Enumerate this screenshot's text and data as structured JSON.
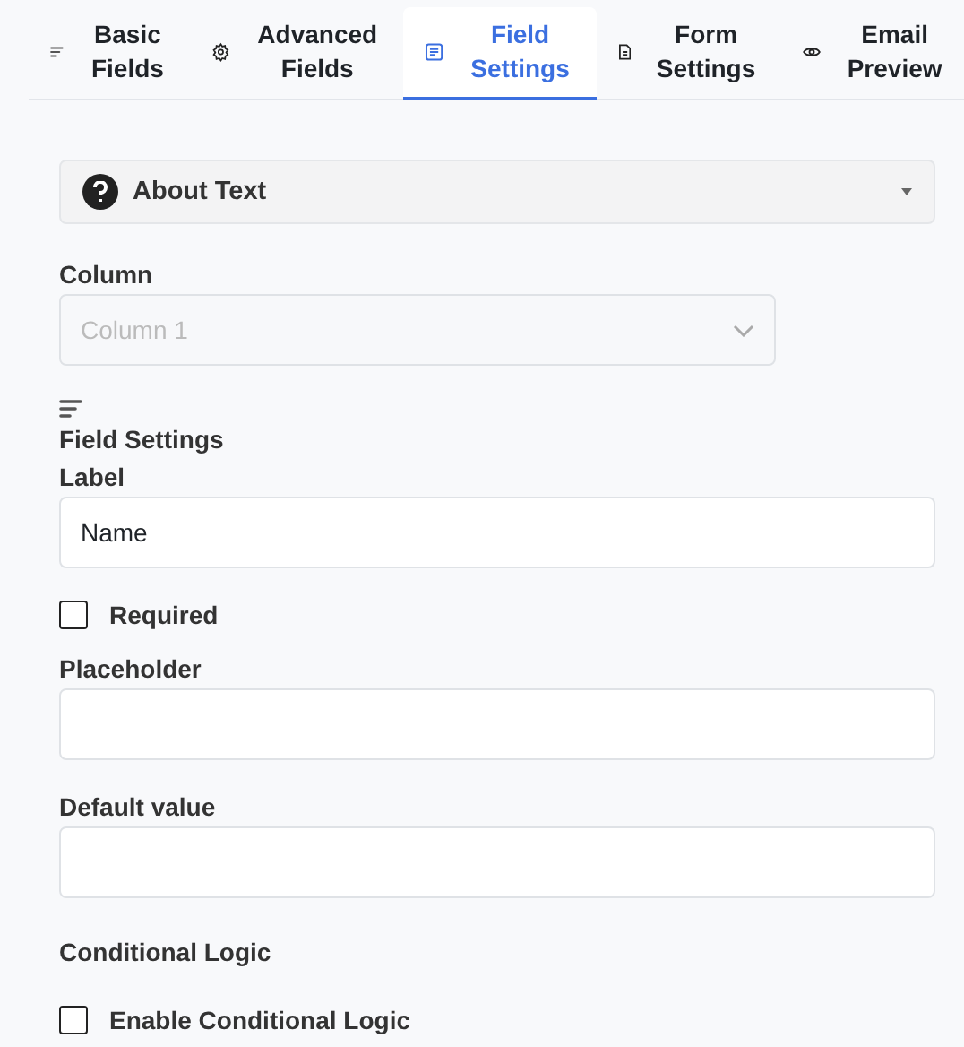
{
  "tabs": [
    {
      "label": "Basic Fields",
      "kind": "lines",
      "selected": false
    },
    {
      "label": "Advanced Fields",
      "kind": "gear",
      "selected": false
    },
    {
      "label": "Field Settings",
      "kind": "doc",
      "selected": true
    },
    {
      "label": "Form Settings",
      "kind": "file",
      "selected": false
    },
    {
      "label": "Email Preview",
      "kind": "eye",
      "selected": false
    }
  ],
  "accordion": {
    "title": "About Text",
    "expanded": false
  },
  "form": [
    {
      "kind": "select",
      "label": "Column",
      "value": "Column 1",
      "disabled": true
    },
    {
      "kind": "heading",
      "title": "Field Settings"
    },
    {
      "kind": "text",
      "label": "Label",
      "value": "Name"
    },
    {
      "kind": "checkbox",
      "label": "Required",
      "checked": false
    },
    {
      "kind": "text",
      "label": "Placeholder"
    },
    {
      "kind": "text",
      "label": "Default value"
    },
    {
      "kind": "section",
      "title": "Conditional Logic"
    },
    {
      "kind": "checkbox",
      "label": "Enable Conditional Logic",
      "checked": false
    }
  ]
}
